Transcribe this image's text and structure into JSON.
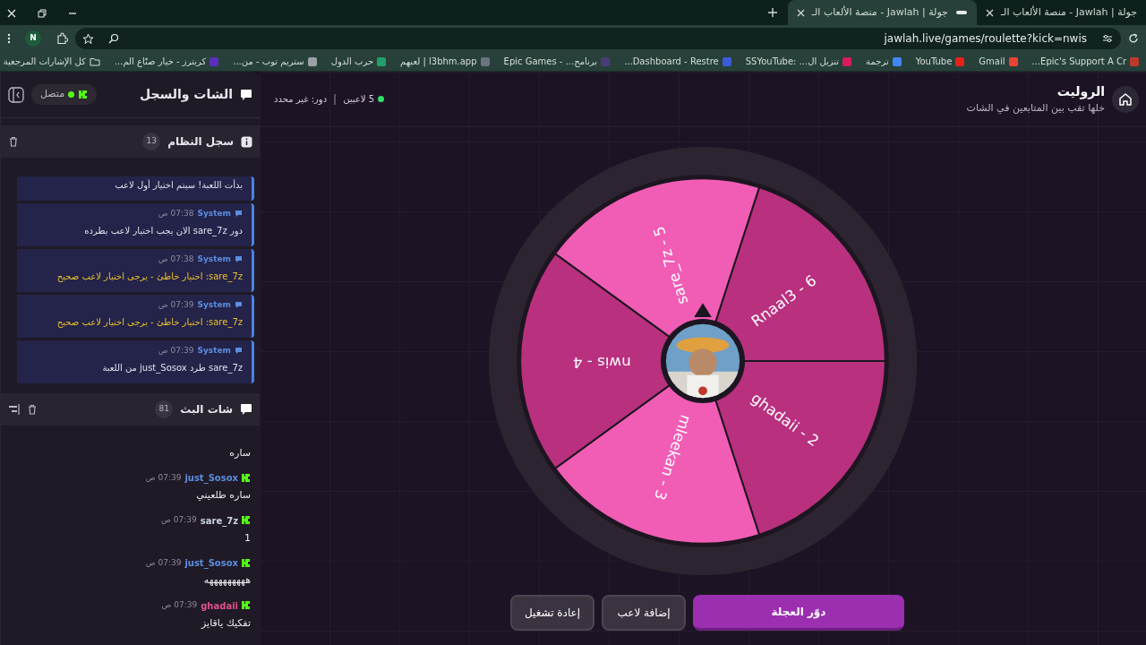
{
  "browser": {
    "tabs": [
      {
        "title": "جولة | Jawlah - منصة الألعاب الـ",
        "selected": false
      },
      {
        "title": "جولة | Jawlah - منصة الألعاب الـ",
        "selected": true
      }
    ],
    "profile_initial": "N",
    "address": "jawlah.live/games/roulette?kick=nwis",
    "bookmarks": [
      {
        "label": "Epic's Support A Cr...",
        "color": "#c0392b"
      },
      {
        "label": "Gmail",
        "color": "#ea4335"
      },
      {
        "label": "YouTube",
        "color": "#e62117"
      },
      {
        "label": "ترجمة",
        "color": "#4285f4"
      },
      {
        "label": "تنزيل ال... :SSYouTube",
        "color": "#d81b60"
      },
      {
        "label": "Dashboard - Restre...",
        "color": "#3b5bdb"
      },
      {
        "label": "برنامج... - Epic Games",
        "color": "#4b3b78"
      },
      {
        "label": "l3bhm.app | لعبهم",
        "color": "#6b7280"
      },
      {
        "label": "حرب الدول",
        "color": "#22a06b"
      },
      {
        "label": "ستريم توب - من...",
        "color": "#9aa0a6"
      },
      {
        "label": "كريترز - خيار صنّاع الم...",
        "color": "#5b2dbd"
      }
    ],
    "all_bookmarks": "كل الإشارات المرجعية"
  },
  "sidebar": {
    "title": "الشات والسجل",
    "status": "متصل",
    "connected": true,
    "system_log": {
      "title": "سجل النظام",
      "count": "13",
      "entries": [
        {
          "text": "بدأت اللعبة! سيتم اختيار أول لاعب",
          "kind": "info"
        },
        {
          "sender": "System",
          "time": "07:38 ص",
          "text": "دور sare_7z الان يجب اختيار لاعب يطرده",
          "kind": "info"
        },
        {
          "sender": "System",
          "time": "07:38 ص",
          "text": "sare_7z: اختيار خاطئ - يرجى اختيار لاعب صحيح",
          "kind": "warning"
        },
        {
          "sender": "System",
          "time": "07:39 ص",
          "text": "sare_7z: اختيار خاطئ - يرجى اختيار لاعب صحيح",
          "kind": "warning"
        },
        {
          "sender": "System",
          "time": "07:39 ص",
          "text": "sare_7z طرد just_Sosox من اللعبة",
          "kind": "info"
        }
      ]
    },
    "stream_chat": {
      "title": "شات البث",
      "count": "81",
      "messages": [
        {
          "text": "ساره"
        },
        {
          "user": "just_Sosox",
          "color": "#5b8de0",
          "time": "07:39 ص",
          "text": "ساره طلعيني"
        },
        {
          "user": "sare_7z",
          "color": "#c9d2e3",
          "time": "07:39 ص",
          "text": "1"
        },
        {
          "user": "just_Sosox",
          "color": "#5b8de0",
          "time": "07:39 ص",
          "text": "هههههههههه"
        },
        {
          "user": "ghadaii",
          "color": "#e0508a",
          "time": "07:39 ص",
          "text": "تفكيك ياقايز"
        }
      ]
    }
  },
  "game": {
    "title": "الروليت",
    "subtitle": "خلها تقب بين المتابعين في الشات",
    "players": "5 لاعبين",
    "turn": "دور: غير محدد",
    "segments": [
      {
        "label": "Rnaal3 - 6",
        "color": "#b9307f"
      },
      {
        "label": "ghadaii - 2",
        "color": "#b9307f"
      },
      {
        "label": "mleekan - 3",
        "color": "#f15db5"
      },
      {
        "label": "nwis - 4",
        "color": "#b9307f"
      },
      {
        "label": "sare_7z - 5",
        "color": "#f15db5"
      }
    ],
    "buttons": [
      {
        "label": "دوّر العجلة",
        "kind": "primary"
      },
      {
        "label": "إضافة لاعب",
        "kind": "secondary"
      },
      {
        "label": "إعادة تشغيل",
        "kind": "secondary"
      }
    ]
  }
}
